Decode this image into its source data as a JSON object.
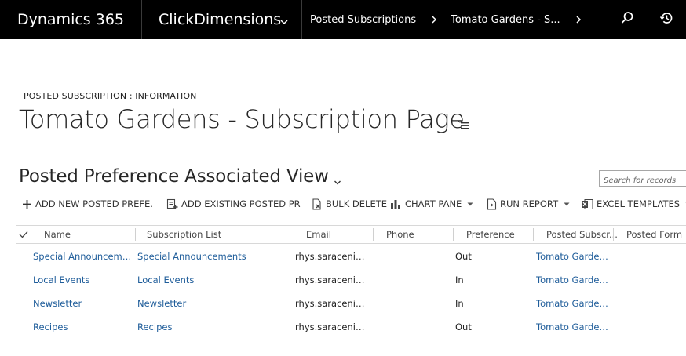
{
  "nav": {
    "app_name": "Dynamics 365",
    "module_name": "ClickDimensions",
    "breadcrumbs": [
      "Posted Subscriptions",
      "Tomato Gardens - S..."
    ],
    "icons": [
      "chevron-down-icon",
      "chevron-right-icon",
      "search-icon",
      "history-icon"
    ]
  },
  "form": {
    "type_label": "POSTED SUBSCRIPTION : INFORMATION",
    "title": "Tomato Gardens - Subscription Page"
  },
  "view": {
    "title": "Posted Preference Associated View",
    "search_placeholder": "Search for records"
  },
  "commands": [
    {
      "label": "ADD NEW POSTED PREFE...",
      "icon": "plus-icon"
    },
    {
      "label": "ADD EXISTING POSTED PR...",
      "icon": "add-existing-icon"
    },
    {
      "label": "BULK DELETE",
      "icon": "bulk-delete-icon"
    },
    {
      "label": "CHART PANE",
      "icon": "chart-icon",
      "has_dropdown": true
    },
    {
      "label": "RUN REPORT",
      "icon": "report-icon",
      "has_dropdown": true
    },
    {
      "label": "EXCEL TEMPLATES",
      "icon": "excel-icon",
      "has_dropdown": true
    }
  ],
  "grid": {
    "columns": [
      "Name",
      "Subscription List",
      "Email",
      "Phone",
      "Preference",
      "Posted Subscr...",
      "Posted Form"
    ],
    "rows": [
      {
        "name": "Special Announceme...",
        "subscription_list": "Special Announcements",
        "email": "rhys.saraceni@c...",
        "phone": "",
        "preference": "Out",
        "posted_subscription": "Tomato Garden...",
        "posted_form": ""
      },
      {
        "name": "Local Events",
        "subscription_list": "Local Events",
        "email": "rhys.saraceni@c...",
        "phone": "",
        "preference": "In",
        "posted_subscription": "Tomato Garden...",
        "posted_form": ""
      },
      {
        "name": "Newsletter",
        "subscription_list": "Newsletter",
        "email": "rhys.saraceni@c...",
        "phone": "",
        "preference": "In",
        "posted_subscription": "Tomato Garden...",
        "posted_form": ""
      },
      {
        "name": "Recipes",
        "subscription_list": "Recipes",
        "email": "rhys.saraceni@c...",
        "phone": "",
        "preference": "Out",
        "posted_subscription": "Tomato Garden...",
        "posted_form": ""
      }
    ]
  },
  "colors": {
    "nav_bg": "#000000",
    "link": "#1f5d9a",
    "title_text": "#262626"
  }
}
